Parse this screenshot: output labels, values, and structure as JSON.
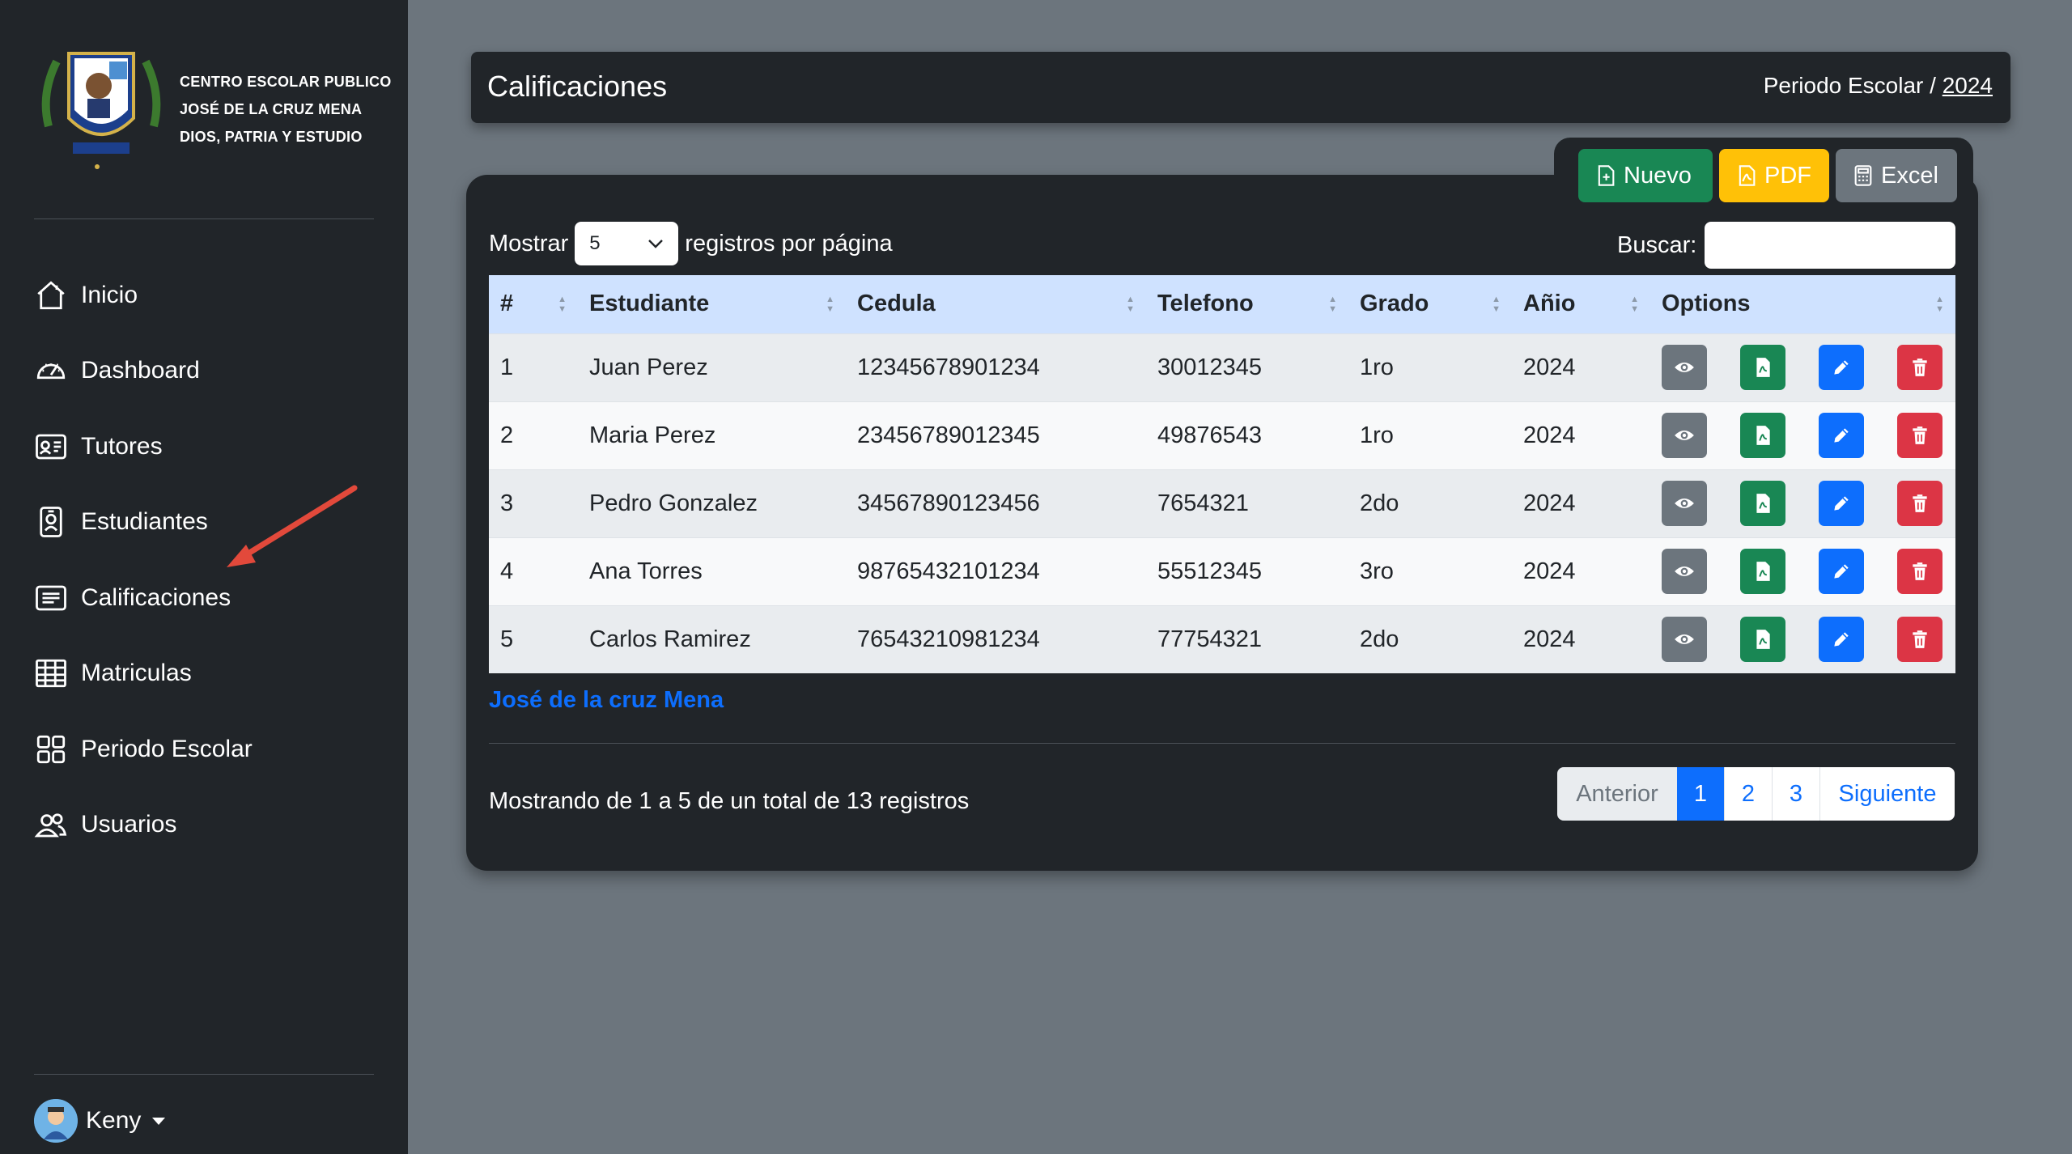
{
  "brand": {
    "lines": [
      "CENTRO ESCOLAR PUBLICO",
      "JOSÉ DE LA CRUZ MENA",
      "DIOS, PATRIA Y ESTUDIO"
    ]
  },
  "sidebar": {
    "items": [
      {
        "label": "Inicio",
        "icon": "house-icon"
      },
      {
        "label": "Dashboard",
        "icon": "speedometer-icon"
      },
      {
        "label": "Tutores",
        "icon": "person-card-icon"
      },
      {
        "label": "Estudiantes",
        "icon": "badge-icon"
      },
      {
        "label": "Calificaciones",
        "icon": "list-card-icon"
      },
      {
        "label": "Matriculas",
        "icon": "table-icon"
      },
      {
        "label": "Periodo Escolar",
        "icon": "grid-icon"
      },
      {
        "label": "Usuarios",
        "icon": "people-icon"
      }
    ],
    "user": "Keny"
  },
  "header": {
    "title": "Calificaciones",
    "period_label": "Periodo Escolar / ",
    "period_year": "2024"
  },
  "toolbar": {
    "new_label": "Nuevo",
    "pdf_label": "PDF",
    "excel_label": "Excel"
  },
  "length": {
    "prefix": "Mostrar",
    "value": "5",
    "suffix": "registros por página"
  },
  "search": {
    "label": "Buscar:",
    "value": ""
  },
  "table": {
    "headers": [
      "#",
      "Estudiante",
      "Cedula",
      "Telefono",
      "Grado",
      "Añio",
      "Options"
    ],
    "rows": [
      [
        "1",
        "Juan Perez",
        "12345678901234",
        "30012345",
        "1ro",
        "2024"
      ],
      [
        "2",
        "Maria Perez",
        "23456789012345",
        "49876543",
        "1ro",
        "2024"
      ],
      [
        "3",
        "Pedro Gonzalez",
        "34567890123456",
        "7654321",
        "2do",
        "2024"
      ],
      [
        "4",
        "Ana Torres",
        "98765432101234",
        "55512345",
        "3ro",
        "2024"
      ],
      [
        "5",
        "Carlos Ramirez",
        "76543210981234",
        "77754321",
        "2do",
        "2024"
      ]
    ]
  },
  "footer": {
    "school_link": "José de la cruz Mena",
    "info": "Mostrando de 1 a 5 de un total de 13 registros"
  },
  "pagination": {
    "prev": "Anterior",
    "pages": [
      "1",
      "2",
      "3"
    ],
    "next": "Siguiente"
  },
  "colors": {
    "sidebar": "#212529",
    "background": "#6c757d",
    "header_row": "#cfe2ff",
    "primary": "#0d6efd",
    "success": "#198754",
    "warning": "#ffc107",
    "danger": "#dc3545",
    "arrow": "#e2493b"
  }
}
